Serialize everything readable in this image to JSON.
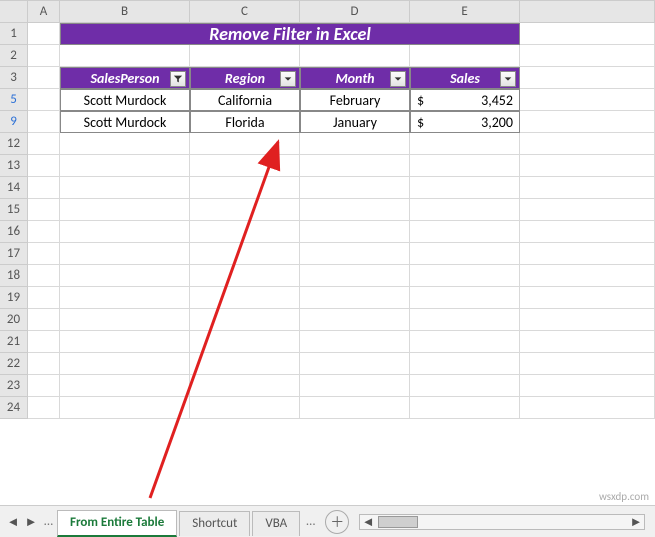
{
  "columns": [
    "A",
    "B",
    "C",
    "D",
    "E"
  ],
  "row_numbers": [
    "1",
    "2",
    "3",
    "5",
    "9",
    "12",
    "13",
    "14",
    "15",
    "16",
    "17",
    "18",
    "19",
    "20",
    "21",
    "22",
    "23",
    "24"
  ],
  "filtered_rows": [
    "5",
    "9"
  ],
  "title": "Remove Filter in Excel",
  "headers": {
    "b": "SalesPerson",
    "c": "Region",
    "d": "Month",
    "e": "Sales"
  },
  "rows": [
    {
      "person": "Scott Murdock",
      "region": "California",
      "month": "February",
      "sales_sym": "$",
      "sales_val": "3,452"
    },
    {
      "person": "Scott Murdock",
      "region": "Florida",
      "month": "January",
      "sales_sym": "$",
      "sales_val": "3,200"
    }
  ],
  "tabs": {
    "active": "From Entire Table",
    "t2": "Shortcut",
    "t3": "VBA"
  },
  "watermark": "wsxdp.com"
}
